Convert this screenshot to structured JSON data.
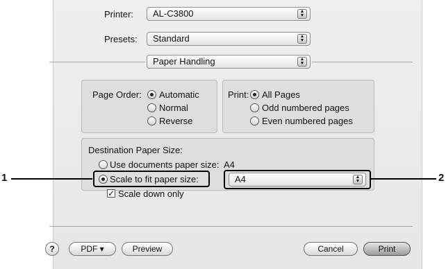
{
  "printer": {
    "label": "Printer:",
    "value": "AL-C3800"
  },
  "presets": {
    "label": "Presets:",
    "value": "Standard"
  },
  "section": {
    "value": "Paper Handling"
  },
  "page_order": {
    "label": "Page Order:",
    "options": [
      "Automatic",
      "Normal",
      "Reverse"
    ],
    "selected": "Automatic"
  },
  "print_pages": {
    "label": "Print:",
    "options": [
      "All Pages",
      "Odd numbered pages",
      "Even numbered pages"
    ],
    "selected": "All Pages"
  },
  "destination": {
    "label": "Destination Paper Size:",
    "use_docs_label": "Use documents paper size:",
    "use_docs_value": "A4",
    "scale_label": "Scale to fit paper size:",
    "scale_value": "A4",
    "scale_down_label": "Scale down only",
    "scale_down_checked": true
  },
  "callouts": {
    "one": "1",
    "two": "2"
  },
  "footer": {
    "help": "?",
    "pdf": "PDF ▾",
    "preview": "Preview",
    "cancel": "Cancel",
    "print": "Print"
  }
}
